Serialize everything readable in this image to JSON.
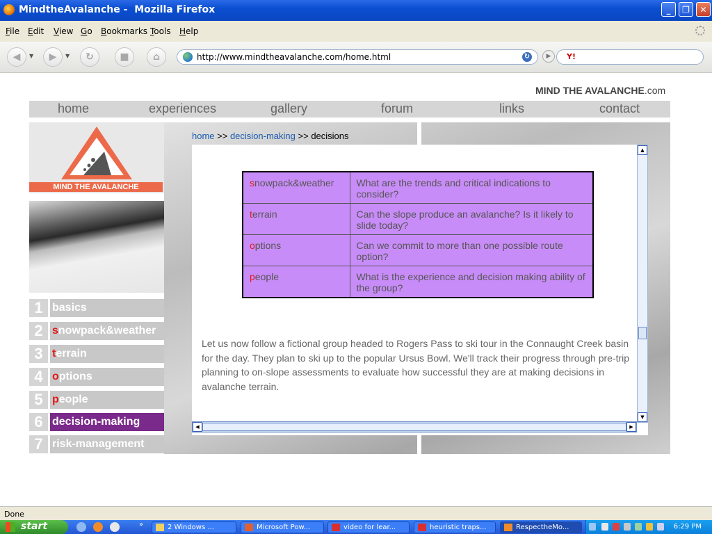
{
  "window": {
    "title": "MindtheAvalanche -  Mozilla Firefox"
  },
  "menu": [
    "File",
    "Edit",
    "View",
    "Go",
    "Bookmarks",
    "Tools",
    "Help"
  ],
  "menu_mnemonics": [
    "F",
    "E",
    "V",
    "G",
    "B",
    "T",
    "H"
  ],
  "navbar": {
    "url": "http://www.mindtheavalanche.com/home.html",
    "search_engine_icon": "Y!"
  },
  "site": {
    "brand_bold": "MIND THE AVALANCHE",
    "brand_suffix": ".com",
    "logo_text": "MIND THE AVALANCHE",
    "topnav": [
      "home",
      "experiences",
      "gallery",
      "forum",
      "links",
      "contact"
    ],
    "breadcrumb": {
      "home": "home",
      "sep1": " >> ",
      "decision": "decision-making",
      "sep2": " >> ",
      "current": "decisions"
    },
    "sidebar": [
      {
        "num": "1",
        "first": "",
        "rest": "basics"
      },
      {
        "num": "2",
        "first": "s",
        "rest": "nowpack&weather"
      },
      {
        "num": "3",
        "first": "t",
        "rest": "errain"
      },
      {
        "num": "4",
        "first": "o",
        "rest": "ptions"
      },
      {
        "num": "5",
        "first": "p",
        "rest": "eople"
      },
      {
        "num": "6",
        "first": "",
        "rest": "decision-making"
      },
      {
        "num": "7",
        "first": "",
        "rest": "risk-management"
      }
    ],
    "table": [
      {
        "first": "s",
        "rest": "nowpack&weather",
        "question": "What are the trends and critical indications to consider?"
      },
      {
        "first": "t",
        "rest": "errain",
        "question": "Can the slope produce an avalanche? Is it likely to slide today?"
      },
      {
        "first": "o",
        "rest": "ptions",
        "question": "Can we commit to more than one possible route option?"
      },
      {
        "first": "p",
        "rest": "eople",
        "question": "What is the experience and decision making ability of the group?"
      }
    ],
    "body_text": "Let us now follow a fictional group headed to Rogers Pass to ski tour in the Connaught Creek basin for the day. They plan to ski up to the popular Ursus Bowl. We'll track their progress through pre-trip planning to on-slope assessments to evaluate how successful they are at making decisions in avalanche terrain."
  },
  "status": {
    "text": "Done"
  },
  "taskbar": {
    "start": "start",
    "more": "»",
    "buttons": [
      "2 Windows ...",
      "Microsoft Pow...",
      "video for lear...",
      "heuristic traps...",
      "RespectheMo..."
    ],
    "clock": "6:29 PM"
  },
  "colors": {
    "table_purple": "#c88cf8",
    "active_sidebar": "#7a2a8a",
    "accent_red": "#e21a1a",
    "link_blue": "#1a5ab0"
  }
}
